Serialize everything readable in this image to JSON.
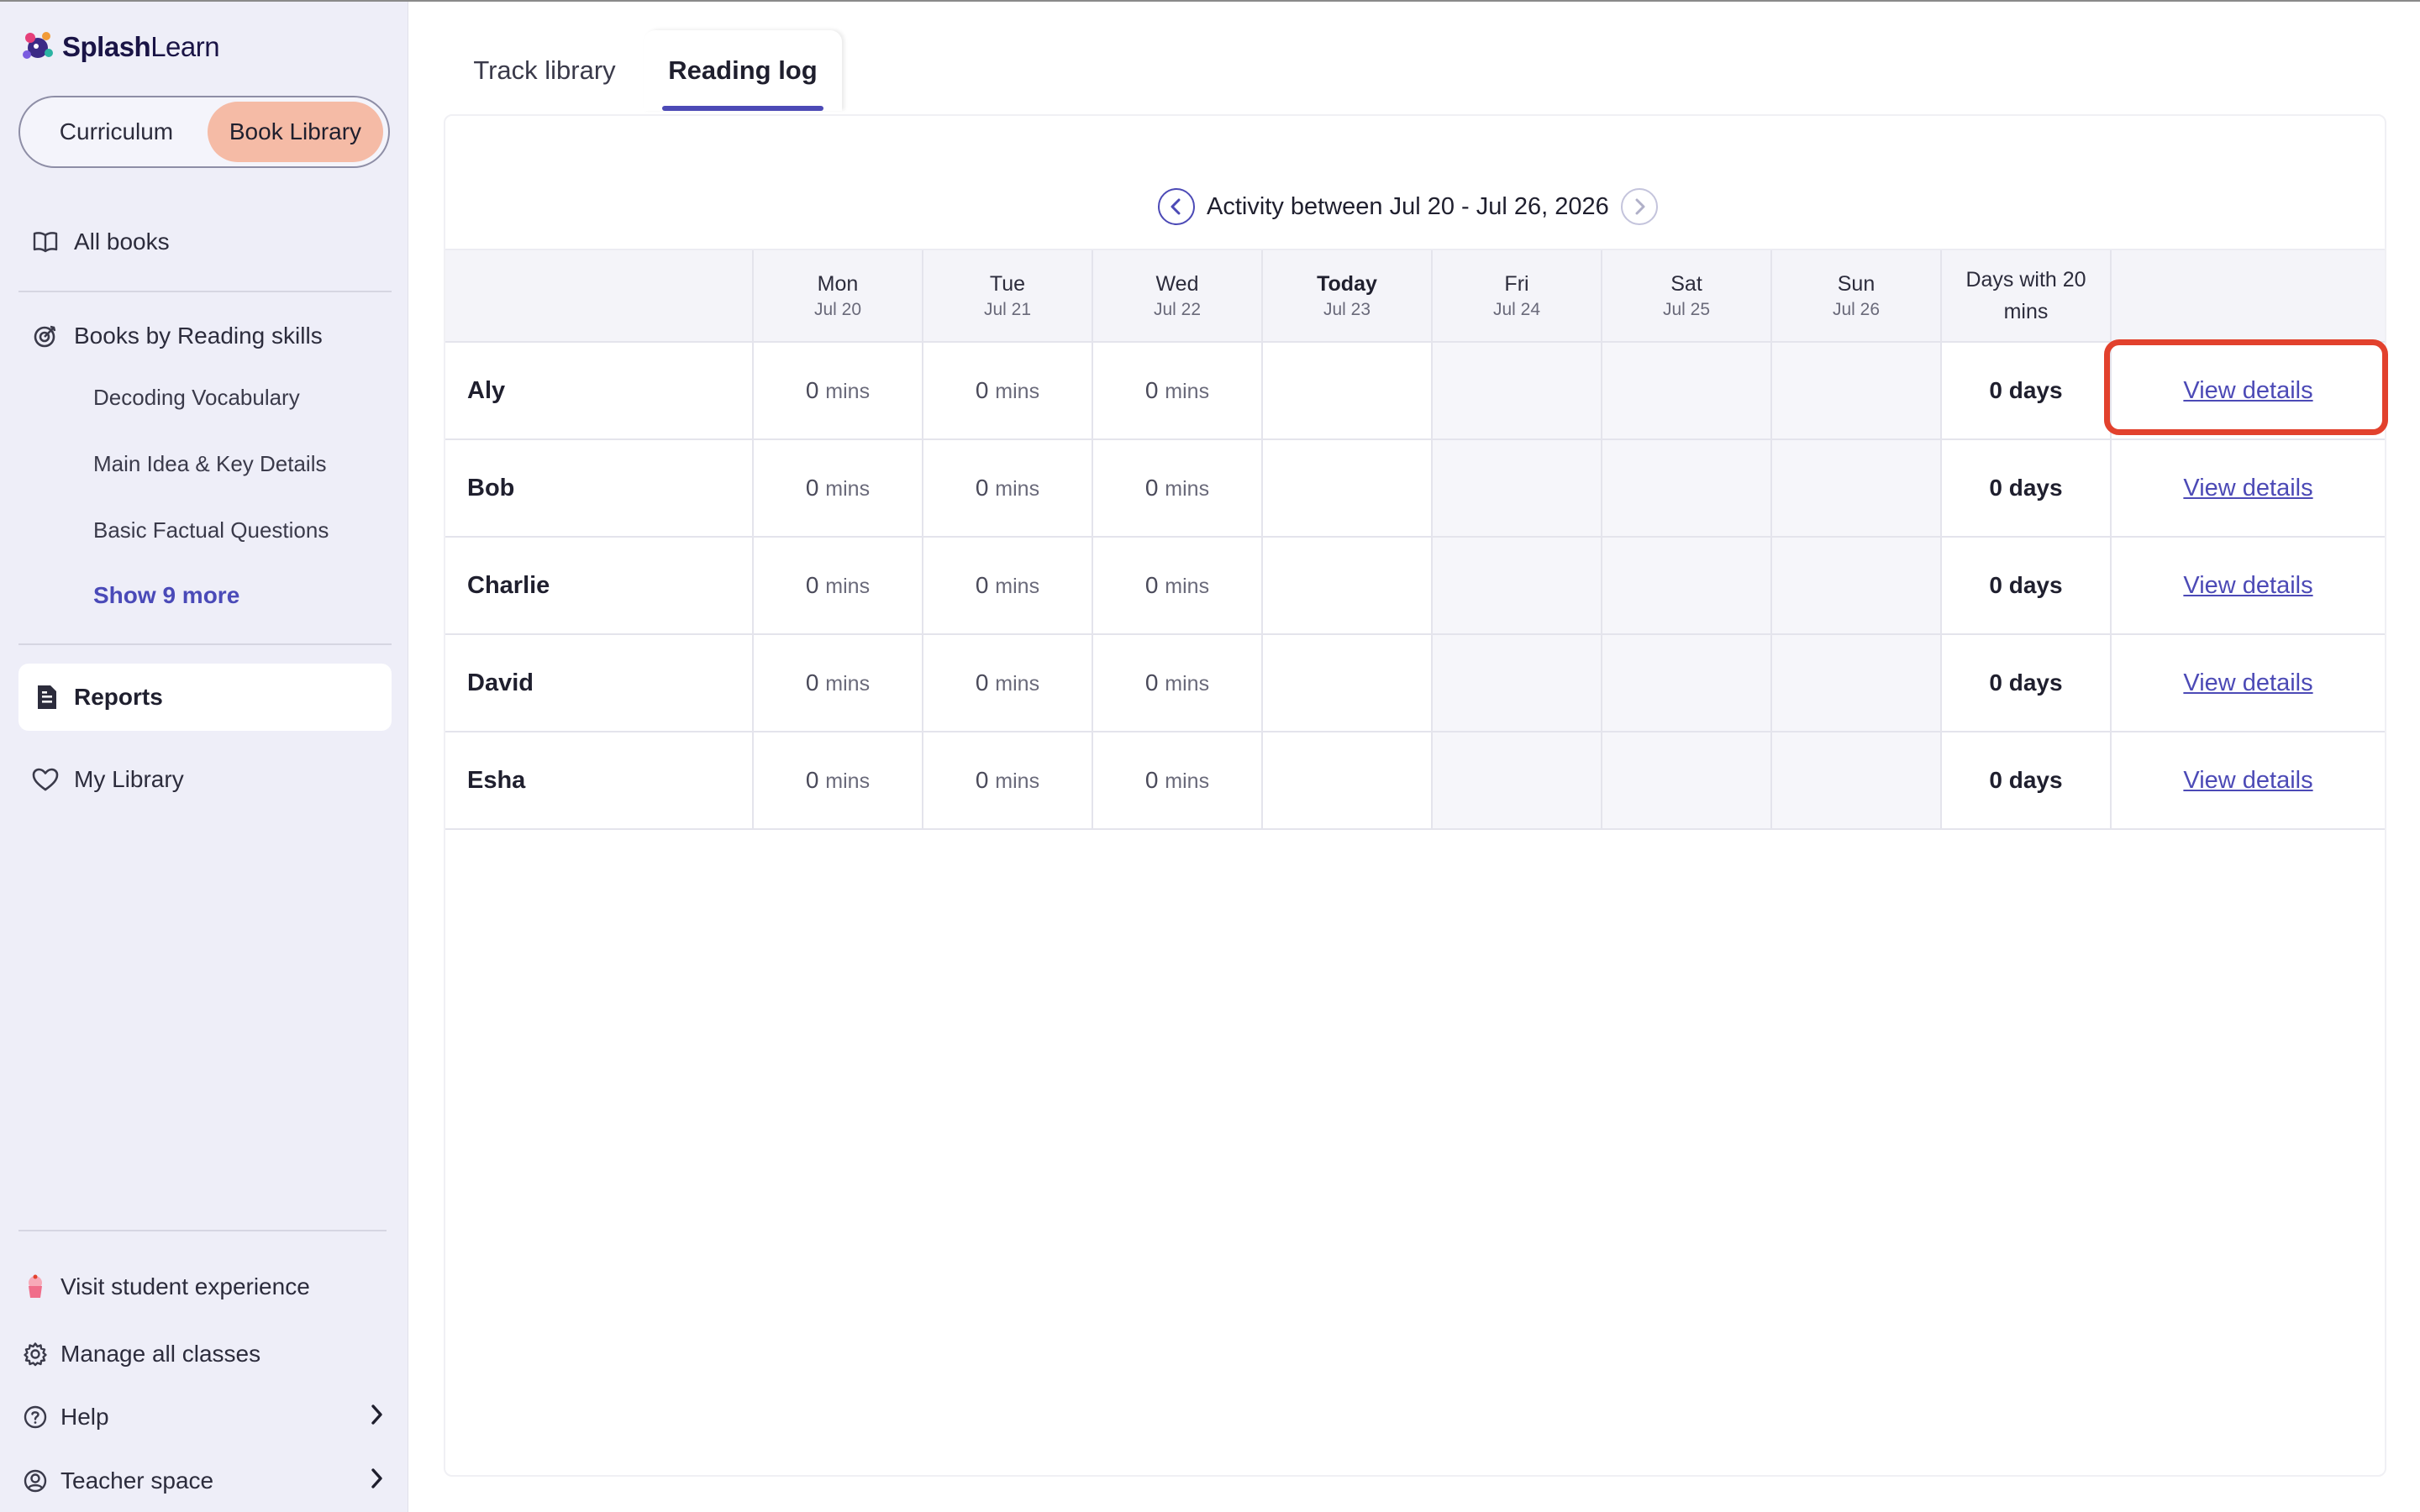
{
  "app": {
    "logo_bold": "Splash",
    "logo_rest": "Learn"
  },
  "sidebar": {
    "toggle": {
      "curriculum": "Curriculum",
      "book_library": "Book Library"
    },
    "all_books": "All books",
    "reading_skills": {
      "title": "Books by Reading skills",
      "items": [
        "Decoding Vocabulary",
        "Main Idea & Key Details",
        "Basic Factual Questions"
      ],
      "show_more": "Show 9 more"
    },
    "reports": "Reports",
    "my_library": "My Library",
    "bottom": {
      "visit": "Visit student experience",
      "manage": "Manage all classes",
      "help": "Help",
      "teacher": "Teacher space"
    }
  },
  "tabs": {
    "track": "Track library",
    "reading_log": "Reading log"
  },
  "week": {
    "label": "Activity between Jul 20 - Jul 26, 2026"
  },
  "table": {
    "columns": [
      {
        "day": "Mon",
        "date": "Jul 20"
      },
      {
        "day": "Tue",
        "date": "Jul 21"
      },
      {
        "day": "Wed",
        "date": "Jul 22"
      },
      {
        "day": "Today",
        "date": "Jul 23"
      },
      {
        "day": "Fri",
        "date": "Jul 24"
      },
      {
        "day": "Sat",
        "date": "Jul 25"
      },
      {
        "day": "Sun",
        "date": "Jul 26"
      }
    ],
    "days_header": "Days with 20 mins",
    "mins_unit": "mins",
    "rows": [
      {
        "name": "Aly",
        "mon": "0",
        "tue": "0",
        "wed": "0",
        "days": "0 days",
        "link": "View details"
      },
      {
        "name": "Bob",
        "mon": "0",
        "tue": "0",
        "wed": "0",
        "days": "0 days",
        "link": "View details"
      },
      {
        "name": "Charlie",
        "mon": "0",
        "tue": "0",
        "wed": "0",
        "days": "0 days",
        "link": "View details"
      },
      {
        "name": "David",
        "mon": "0",
        "tue": "0",
        "wed": "0",
        "days": "0 days",
        "link": "View details"
      },
      {
        "name": "Esha",
        "mon": "0",
        "tue": "0",
        "wed": "0",
        "days": "0 days",
        "link": "View details"
      }
    ]
  },
  "colors": {
    "accent": "#4c4ab6",
    "highlight": "#e2412d",
    "toggle_active": "#f5bba6",
    "sidebar_bg": "#eeeef8"
  }
}
